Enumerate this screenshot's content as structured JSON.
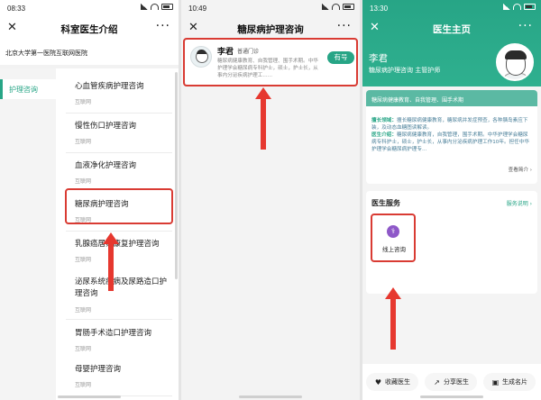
{
  "panel1": {
    "status": {
      "time": "08:33"
    },
    "nav": {
      "close": "✕",
      "title": "科室医生介绍",
      "more": "···"
    },
    "hospital": "北京大学第一医院互联网医院",
    "sidebar": {
      "items": [
        {
          "label": "护理咨询"
        }
      ]
    },
    "cards": [
      {
        "name": "心血管疾病护理咨询",
        "sub": "互联网"
      },
      {
        "name": "慢性伤口护理咨询",
        "sub": "互联网"
      },
      {
        "name": "血液净化护理咨询",
        "sub": "互联网"
      },
      {
        "name": "糖尿病护理咨询",
        "sub": "互联网"
      },
      {
        "name": "乳腺癌居家康复护理咨询",
        "sub": "互联网"
      },
      {
        "name": "泌尿系统疾病及尿路造口护理咨询",
        "sub": "互联网"
      },
      {
        "name": "胃肠手术造口护理咨询",
        "sub": "互联网"
      },
      {
        "name": "母婴护理咨询",
        "sub": "互联网"
      }
    ]
  },
  "panel2": {
    "status": {
      "time": "10:49"
    },
    "nav": {
      "close": "✕",
      "title": "糖尿病护理咨询",
      "more": "···"
    },
    "doctor": {
      "name": "李君",
      "tag": "普通门诊",
      "desc": "糖尿病健康教育、自我管理、围手术期。中华护理学会糖尿病专科护士，硕士，护士长，从事内分泌疾病护理工......",
      "button": "有号"
    }
  },
  "panel3": {
    "status": {
      "time": "13:30"
    },
    "nav": {
      "close": "✕",
      "title": "医生主页",
      "more": "···"
    },
    "doctor": {
      "name": "李君",
      "title": "糖尿病护理咨询  主管护师"
    },
    "info": {
      "header": "糖尿病健康教育、自我管理、围手术期",
      "specialty_label": "擅长领域：",
      "specialty": "擅长糖尿病健康教育，糖尿病并发症预查，各种胰岛素应下装，及动态血糖图读解读。",
      "intro_label": "医生介绍：",
      "intro": "糖尿病健康教育，自我管理，围手术期。中华护理学会糖尿病专科护士，硕士，护士长，从事内分泌疾病护理工作10年。担任中华护理学会糖尿病护理专...",
      "view_more": "查看简介 ›"
    },
    "services": {
      "title": "医生服务",
      "desc": "服务说明 ›",
      "items": [
        {
          "label": "线上咨询",
          "icon": "stethoscope-icon"
        }
      ]
    },
    "bottom": {
      "favorite": "收藏医生",
      "share": "分享医生",
      "card": "生成名片"
    }
  },
  "colors": {
    "accent": "#27a586",
    "highlight": "#d93b33",
    "arrow": "#e6382f",
    "service_icon": "#8e58c8"
  }
}
